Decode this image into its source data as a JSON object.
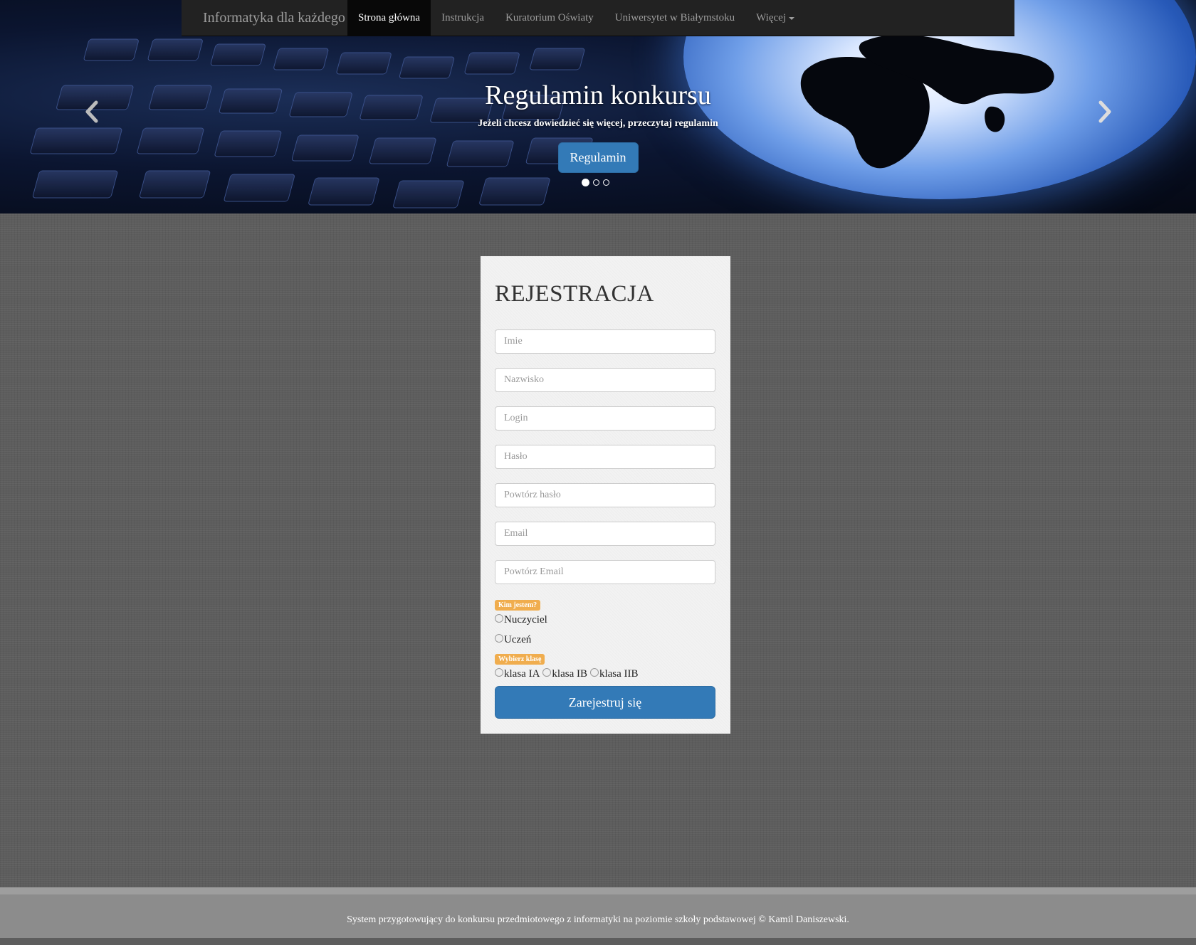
{
  "navbar": {
    "brand": "Informatyka dla każdego",
    "items": [
      {
        "label": "Strona główna",
        "active": true
      },
      {
        "label": "Instrukcja"
      },
      {
        "label": "Kuratorium Oświaty"
      },
      {
        "label": "Uniwersytet w Białymstoku"
      },
      {
        "label": "Więcej",
        "dropdown": true
      }
    ]
  },
  "carousel": {
    "title": "Regulamin konkursu",
    "subtitle": "Jeżeli chcesz dowiedzieć się więcej, przeczytaj regulamin",
    "button": "Regulamin",
    "slides": 3,
    "active_slide": 1,
    "prev_icon": "chevron-left-icon",
    "next_icon": "chevron-right-icon"
  },
  "form": {
    "title": "REJESTRACJA",
    "fields": {
      "first_name": "Imie",
      "last_name": "Nazwisko",
      "login": "Login",
      "password": "Hasło",
      "password_repeat": "Powtórz hasło",
      "email": "Email",
      "email_repeat": "Powtórz Email"
    },
    "role_label": "Kim jestem?",
    "roles": [
      "Nuczyciel",
      "Uczeń"
    ],
    "class_label": "Wybierz klasę",
    "classes": [
      "klasa IA",
      "klasa IB",
      "klasa IIB"
    ],
    "submit": "Zarejestruj się"
  },
  "footer": {
    "text": "System przygotowujący do konkursu przedmiotowego z informatyki na poziomie szkoły podstawowej © Kamil Daniszewski."
  },
  "colors": {
    "primary": "#337ab7",
    "badge": "#f0ad4e",
    "navbar": "#222222"
  }
}
